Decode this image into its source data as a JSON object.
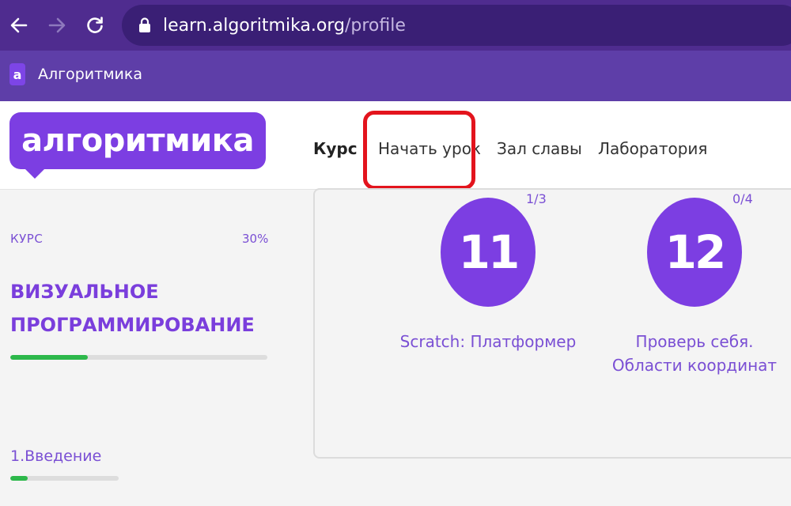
{
  "browser": {
    "url_host": "learn.algoritmika.org",
    "url_path": "/profile",
    "bookmark": {
      "favicon_letter": "a",
      "label": "Алгоритмика"
    }
  },
  "header": {
    "logo_text": "алгоритмика",
    "nav": [
      {
        "label": "Курс",
        "active": true
      },
      {
        "label": "Начать урок",
        "active": false
      },
      {
        "label": "Зал славы",
        "active": false
      },
      {
        "label": "Лаборатория",
        "active": false
      }
    ]
  },
  "sidebar": {
    "course_label": "КУРС",
    "course_progress_text": "30%",
    "course_progress": 0.3,
    "course_title_line1": "ВИЗУАЛЬНОЕ",
    "course_title_line2": "ПРОГРАММИРОВАНИЕ",
    "lesson_label": "1.Введение",
    "lesson_progress": 0.16
  },
  "lessons": [
    {
      "number": "11",
      "progress": "1/3",
      "name_line1": "Scratch: Платформер",
      "name_line2": ""
    },
    {
      "number": "12",
      "progress": "0/4",
      "name_line1": "Проверь себя.",
      "name_line2": "Области координат"
    }
  ],
  "colors": {
    "accent": "#7c3ee2",
    "progress_fill": "#2db84b",
    "highlight": "#e3141d",
    "chrome": "#4f2c8f"
  }
}
